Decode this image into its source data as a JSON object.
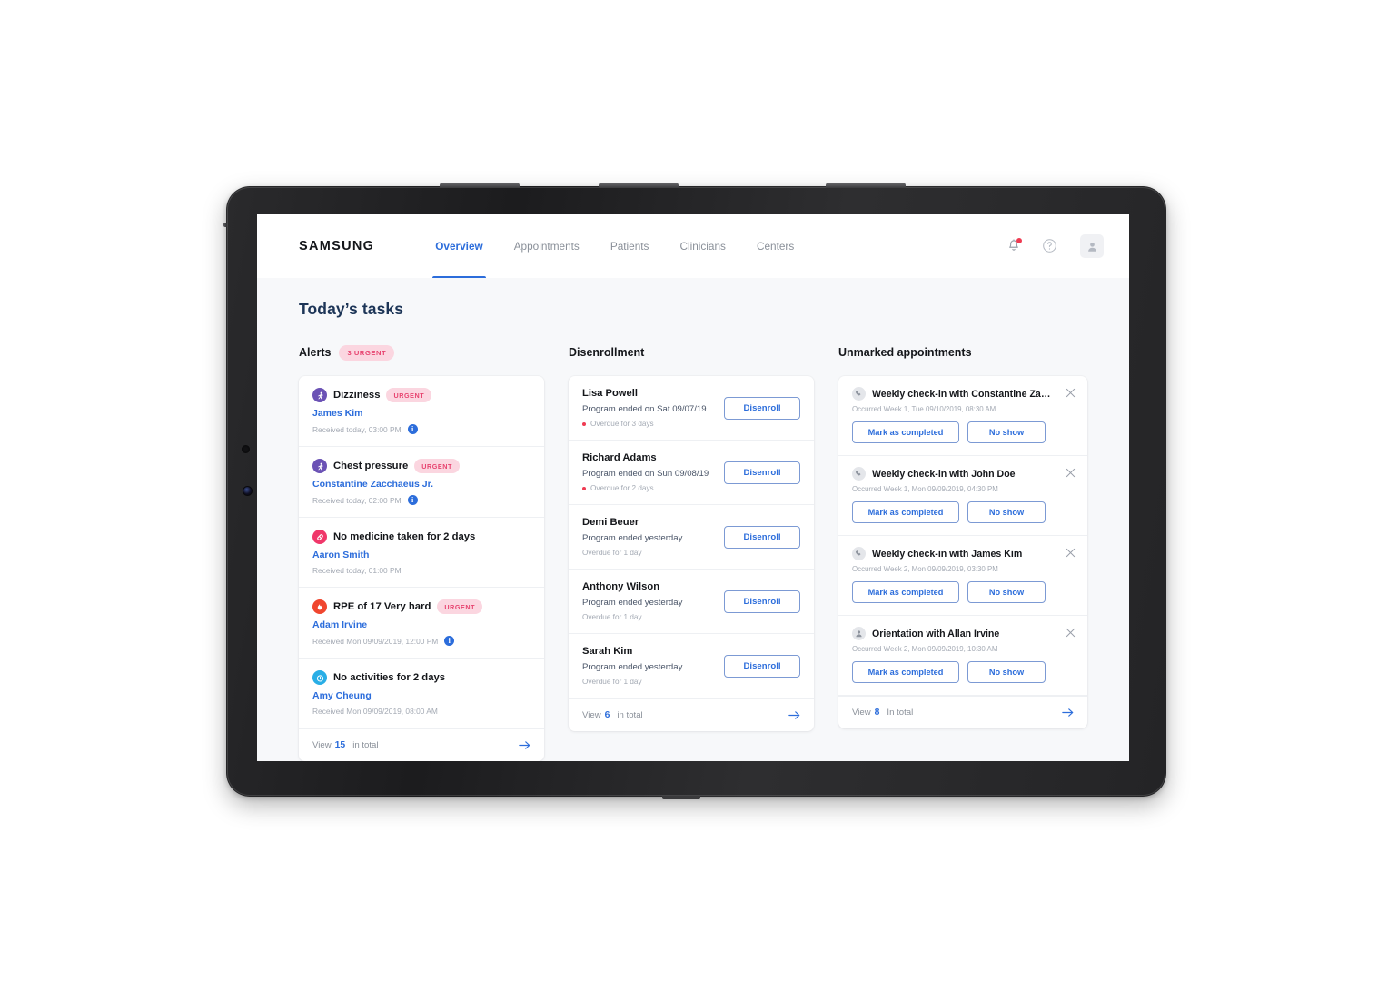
{
  "nav": {
    "logo": "SAMSUNG",
    "items": [
      {
        "label": "Overview",
        "active": true
      },
      {
        "label": "Appointments",
        "active": false
      },
      {
        "label": "Patients",
        "active": false
      },
      {
        "label": "Clinicians",
        "active": false
      },
      {
        "label": "Centers",
        "active": false
      }
    ],
    "icons": [
      "notification-bell-icon",
      "help-circle-icon",
      "user-avatar-icon"
    ]
  },
  "page": {
    "title": "Today’s tasks"
  },
  "colors": {
    "accent_blue": "#2c6ddb",
    "title_navy": "#1d3557",
    "urgent_pink_bg": "#fbd6e0",
    "urgent_pink_text": "#e7436f",
    "alert_purple": "#6b52b5",
    "alert_pink": "#f0376a",
    "alert_red": "#f0462f",
    "alert_cyan": "#29aee6",
    "page_bg": "#f7f8fa"
  },
  "alerts": {
    "title": "Alerts",
    "badge": "3 URGENT",
    "urgent_label": "URGENT",
    "items": [
      {
        "icon": "dizziness-icon",
        "icon_color": "#6b52b5",
        "title": "Dizziness",
        "urgent": true,
        "patient": "James Kim",
        "meta": "Received today, 03:00 PM",
        "info": true
      },
      {
        "icon": "chest-pressure-icon",
        "icon_color": "#6b52b5",
        "title": "Chest pressure",
        "urgent": true,
        "patient": "Constantine Zacchaeus Jr.",
        "meta": "Received today, 02:00 PM",
        "info": true
      },
      {
        "icon": "medicine-pill-icon",
        "icon_color": "#f0376a",
        "title": "No medicine taken for 2 days",
        "urgent": false,
        "patient": "Aaron Smith",
        "meta": "Received today, 01:00 PM",
        "info": false
      },
      {
        "icon": "rpe-flame-icon",
        "icon_color": "#f0462f",
        "title": "RPE of 17 Very hard",
        "urgent": true,
        "patient": "Adam Irvine",
        "meta": "Received Mon 09/09/2019, 12:00 PM",
        "info": true
      },
      {
        "icon": "activity-stopwatch-icon",
        "icon_color": "#29aee6",
        "title": "No activities for 2 days",
        "urgent": false,
        "patient": "Amy Cheung",
        "meta": "Received Mon 09/09/2019, 08:00 AM",
        "info": false
      }
    ],
    "footer": {
      "view": "View",
      "count": "15",
      "in_total": "in total",
      "arrow": "arrow-right-icon"
    }
  },
  "disenrollment": {
    "title": "Disenrollment",
    "button_label": "Disenroll",
    "items": [
      {
        "name": "Lisa Powell",
        "ended": "Program ended on Sat 09/07/19",
        "overdue": "Overdue for 3 days",
        "dot": true
      },
      {
        "name": "Richard Adams",
        "ended": "Program ended on Sun 09/08/19",
        "overdue": "Overdue for 2 days",
        "dot": true
      },
      {
        "name": "Demi Beuer",
        "ended": "Program ended yesterday",
        "overdue": "Overdue for 1 day",
        "dot": false
      },
      {
        "name": "Anthony Wilson",
        "ended": "Program ended yesterday",
        "overdue": "Overdue for 1 day",
        "dot": false
      },
      {
        "name": "Sarah Kim",
        "ended": "Program ended yesterday",
        "overdue": "Overdue for 1 day",
        "dot": false
      }
    ],
    "footer": {
      "view": "View",
      "count": "6",
      "in_total": "in total",
      "arrow": "arrow-right-icon"
    }
  },
  "appointments": {
    "title": "Unmarked appointments",
    "mark_label": "Mark as completed",
    "noshow_label": "No show",
    "items": [
      {
        "icon": "phone-call-icon",
        "title": "Weekly check-in with Constantine Zacc...",
        "meta": "Occurred Week 1, Tue 09/10/2019, 08:30 AM"
      },
      {
        "icon": "phone-call-icon",
        "title": "Weekly check-in with John Doe",
        "meta": "Occurred Week 1, Mon 09/09/2019, 04:30 PM"
      },
      {
        "icon": "phone-call-icon",
        "title": "Weekly check-in with James Kim",
        "meta": "Occurred Week 2, Mon 09/09/2019, 03:30 PM"
      },
      {
        "icon": "person-icon",
        "title": "Orientation with Allan Irvine",
        "meta": "Occurred Week 2, Mon 09/09/2019, 10:30 AM"
      }
    ],
    "footer": {
      "view": "View",
      "count": "8",
      "in_total": "In total",
      "arrow": "arrow-right-icon"
    }
  }
}
